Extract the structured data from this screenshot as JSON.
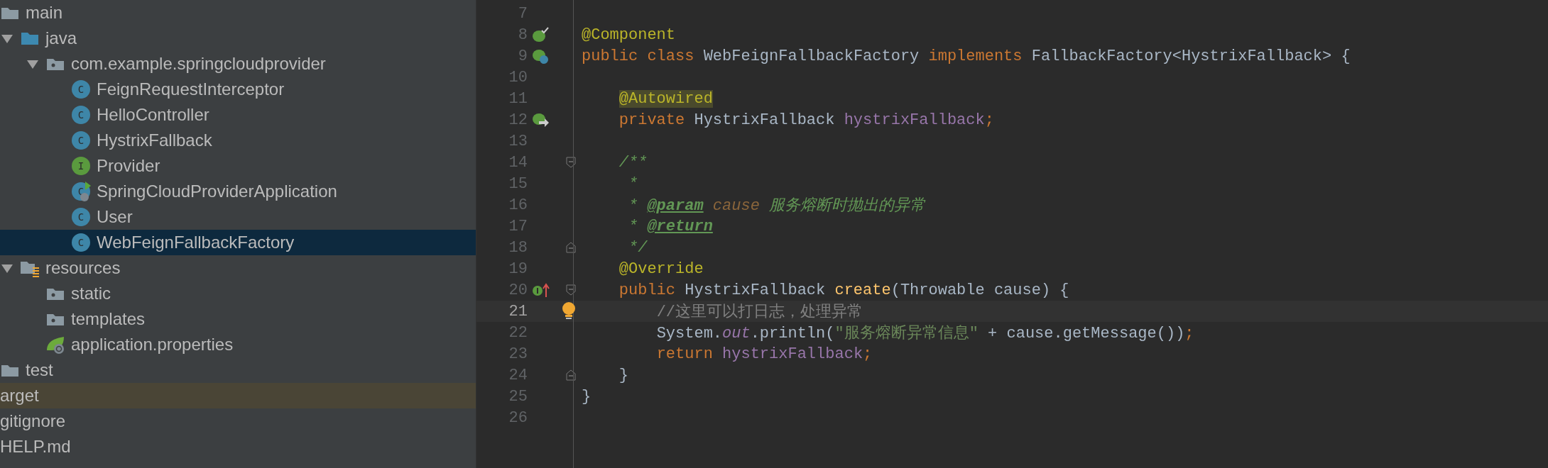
{
  "project_tree": {
    "items": [
      {
        "label": "main",
        "kind": "folder",
        "children": [
          {
            "label": "java",
            "kind": "source-folder",
            "expanded": true,
            "children": [
              {
                "label": "com.example.springcloudprovider",
                "kind": "package",
                "expanded": true,
                "children": [
                  {
                    "label": "FeignRequestInterceptor",
                    "kind": "class",
                    "icon_letter": "C",
                    "selected": false
                  },
                  {
                    "label": "HelloController",
                    "kind": "class",
                    "icon_letter": "C",
                    "selected": false
                  },
                  {
                    "label": "HystrixFallback",
                    "kind": "class",
                    "icon_letter": "C",
                    "selected": false
                  },
                  {
                    "label": "Provider",
                    "kind": "interface",
                    "icon_letter": "I",
                    "selected": false
                  },
                  {
                    "label": "SpringCloudProviderApplication",
                    "kind": "boot-class",
                    "icon_letter": "C",
                    "selected": false
                  },
                  {
                    "label": "User",
                    "kind": "class",
                    "icon_letter": "C",
                    "selected": false
                  },
                  {
                    "label": "WebFeignFallbackFactory",
                    "kind": "class",
                    "icon_letter": "C",
                    "selected": true
                  }
                ]
              }
            ]
          },
          {
            "label": "resources",
            "kind": "resources-folder",
            "expanded": true,
            "children": [
              {
                "label": "static",
                "kind": "package"
              },
              {
                "label": "templates",
                "kind": "package"
              },
              {
                "label": "application.properties",
                "kind": "spring-properties"
              }
            ]
          }
        ]
      },
      {
        "label": "test",
        "kind": "folder"
      }
    ],
    "outer_items": [
      {
        "label": "arget",
        "excluded": true
      },
      {
        "label": "gitignore",
        "excluded": false
      },
      {
        "label": "HELP.md",
        "excluded": false
      }
    ]
  },
  "editor": {
    "lines": [
      {
        "number": "7"
      },
      {
        "number": "8",
        "gutter_mark": {
          "kind": "bean-check"
        },
        "tokens": [
          {
            "text": "@Component",
            "kind": "annotation"
          }
        ]
      },
      {
        "number": "9",
        "gutter_mark": {
          "kind": "bean-class"
        },
        "tokens": [
          {
            "text": "public class ",
            "kind": "keyword"
          },
          {
            "text": "WebFeignFallbackFactory ",
            "kind": "plain"
          },
          {
            "text": "implements ",
            "kind": "keyword"
          },
          {
            "text": "FallbackFactory<HystrixFallback> {",
            "kind": "plain"
          }
        ]
      },
      {
        "number": "10"
      },
      {
        "number": "11",
        "tokens": [
          {
            "text": "    @Autowired",
            "kind": "annotation-marked"
          }
        ]
      },
      {
        "number": "12",
        "gutter_mark": {
          "kind": "autowired"
        },
        "tokens": [
          {
            "text": "    private ",
            "kind": "keyword"
          },
          {
            "text": "HystrixFallback ",
            "kind": "plain"
          },
          {
            "text": "hystrixFallback",
            "kind": "field"
          },
          {
            "text": ";",
            "kind": "keyword"
          }
        ]
      },
      {
        "number": "13"
      },
      {
        "number": "14",
        "fold_mark": {
          "kind": "start"
        },
        "tokens": [
          {
            "text": "    /**",
            "kind": "doc"
          }
        ]
      },
      {
        "number": "15",
        "tokens": [
          {
            "text": "     *",
            "kind": "doc"
          }
        ]
      },
      {
        "number": "16",
        "tokens": [
          {
            "text": "     * ",
            "kind": "doc"
          },
          {
            "text": "@param",
            "kind": "doc-tag"
          },
          {
            "text": " cause",
            "kind": "param-name"
          },
          {
            "text": " 服务熔断时抛出的异常",
            "kind": "doc"
          }
        ]
      },
      {
        "number": "17",
        "tokens": [
          {
            "text": "     * ",
            "kind": "doc"
          },
          {
            "text": "@return",
            "kind": "doc-tag"
          }
        ]
      },
      {
        "number": "18",
        "fold_mark": {
          "kind": "end"
        },
        "tokens": [
          {
            "text": "     */",
            "kind": "doc"
          }
        ]
      },
      {
        "number": "19",
        "tokens": [
          {
            "text": "    @Override",
            "kind": "annotation"
          }
        ]
      },
      {
        "number": "20",
        "gutter_mark": {
          "kind": "implements"
        },
        "fold_mark": {
          "kind": "start"
        },
        "tokens": [
          {
            "text": "    public ",
            "kind": "keyword"
          },
          {
            "text": "HystrixFallback ",
            "kind": "plain"
          },
          {
            "text": "create",
            "kind": "method"
          },
          {
            "text": "(Throwable cause) {",
            "kind": "plain"
          }
        ]
      },
      {
        "number": "21",
        "current": true,
        "bulb": true,
        "tokens": [
          {
            "text": "        //这里可以打日志，处理异常",
            "kind": "comment"
          }
        ]
      },
      {
        "number": "22",
        "tokens": [
          {
            "text": "        System.",
            "kind": "plain"
          },
          {
            "text": "out",
            "kind": "static-field"
          },
          {
            "text": ".println(",
            "kind": "plain"
          },
          {
            "text": "\"服务熔断异常信息\"",
            "kind": "string"
          },
          {
            "text": " + cause.getMessage())",
            "kind": "plain"
          },
          {
            "text": ";",
            "kind": "keyword"
          }
        ]
      },
      {
        "number": "23",
        "tokens": [
          {
            "text": "        return ",
            "kind": "keyword"
          },
          {
            "text": "hystrixFallback",
            "kind": "field"
          },
          {
            "text": ";",
            "kind": "keyword"
          }
        ]
      },
      {
        "number": "24",
        "fold_mark": {
          "kind": "end"
        },
        "tokens": [
          {
            "text": "    }",
            "kind": "plain"
          }
        ]
      },
      {
        "number": "25",
        "tokens": [
          {
            "text": "}",
            "kind": "plain"
          }
        ]
      },
      {
        "number": "26"
      }
    ]
  }
}
